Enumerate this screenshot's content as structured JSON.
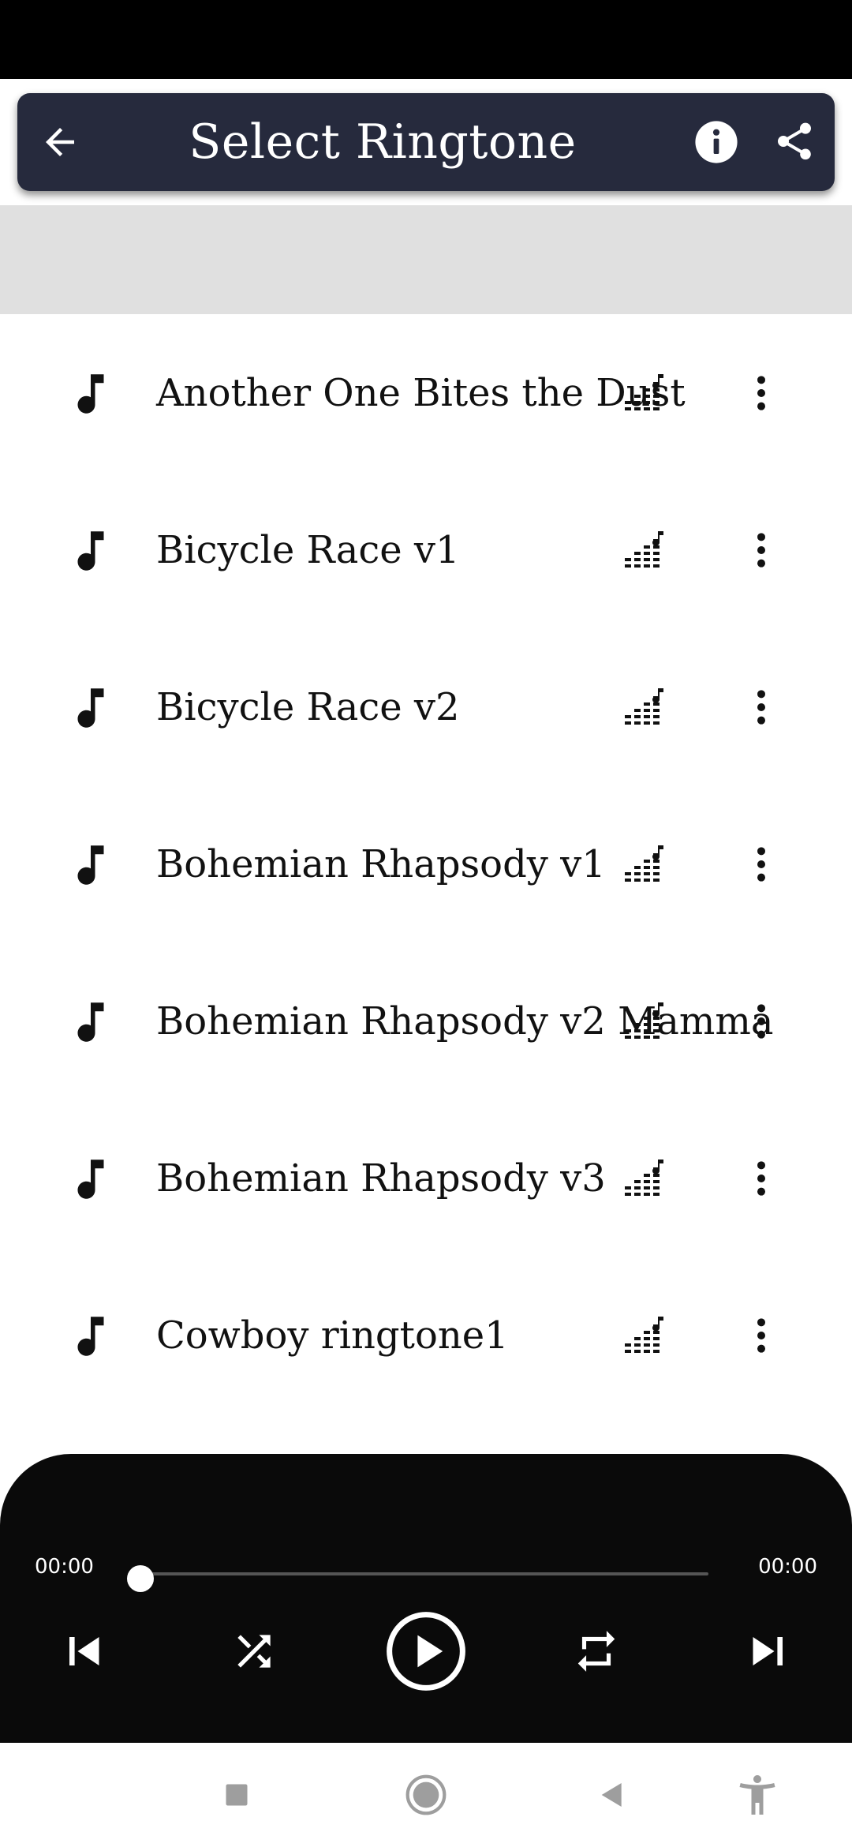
{
  "app_bar": {
    "title": "Select Ringtone",
    "icons": [
      "back-arrow-icon",
      "info-icon",
      "share-icon"
    ],
    "background": "#262a3d"
  },
  "ringtones": [
    {
      "name": "Another One Bites the Dust"
    },
    {
      "name": "Bicycle Race v1"
    },
    {
      "name": "Bicycle Race v2"
    },
    {
      "name": "Bohemian Rhapsody v1"
    },
    {
      "name": "Bohemian Rhapsody v2 Mamma"
    },
    {
      "name": "Bohemian Rhapsody v3"
    },
    {
      "name": "Cowboy ringtone1"
    }
  ],
  "row_icons": [
    "music-note-icon",
    "equalizer-icon",
    "more-vert-icon"
  ],
  "player": {
    "current_time": "00:00",
    "duration": "00:00",
    "progress": 0,
    "controls": [
      "skip-previous-icon",
      "shuffle-icon",
      "play-icon",
      "repeat-icon",
      "skip-next-icon"
    ],
    "background": "#0a0a0a"
  },
  "system_nav": {
    "icons": [
      "recents-square-icon",
      "home-circle-icon",
      "back-triangle-icon",
      "accessibility-icon"
    ]
  }
}
